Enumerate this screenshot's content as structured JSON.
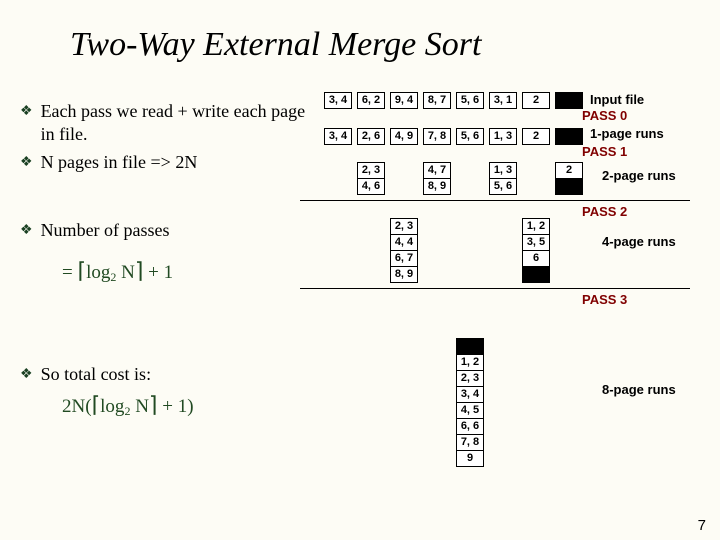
{
  "title": "Two-Way External Merge Sort",
  "bullets": {
    "b1": "Each pass we read + write each page in file.",
    "b2": "N pages in file => 2N",
    "b3": "Number of passes",
    "b4": "So total cost is:"
  },
  "formula": {
    "passes_prefix": "= ",
    "log_text": "log",
    "sub2": "2",
    "N": " N",
    "plus1": " + 1",
    "cost_prefix": "2N",
    "open": "(",
    "close": ")"
  },
  "rows": {
    "input": [
      "3, 4",
      "6, 2",
      "9, 4",
      "8, 7",
      "5, 6",
      "3, 1",
      "2"
    ],
    "pass0": [
      "3, 4",
      "2, 6",
      "4, 9",
      "7, 8",
      "5, 6",
      "1, 3",
      "2"
    ],
    "pass1": {
      "a": [
        "2, 3",
        "4, 6"
      ],
      "b": [
        "4, 7",
        "8, 9"
      ],
      "c": [
        "1, 3",
        "5, 6"
      ],
      "d": [
        "2"
      ]
    },
    "pass2": {
      "a": [
        "2, 3",
        "4, 4",
        "6, 7",
        "8, 9"
      ],
      "b": [
        "1, 2",
        "3, 5",
        "6"
      ]
    },
    "pass3": [
      "1, 2",
      "2, 3",
      "3, 4",
      "4, 5",
      "6, 6",
      "7, 8",
      "9"
    ]
  },
  "labels": {
    "input": "Input file",
    "p0": "PASS 0",
    "r1": "1-page runs",
    "p1": "PASS 1",
    "r2": "2-page runs",
    "p2": "PASS 2",
    "r4": "4-page runs",
    "p3": "PASS 3",
    "r8": "8-page runs"
  },
  "pagenum": "7"
}
